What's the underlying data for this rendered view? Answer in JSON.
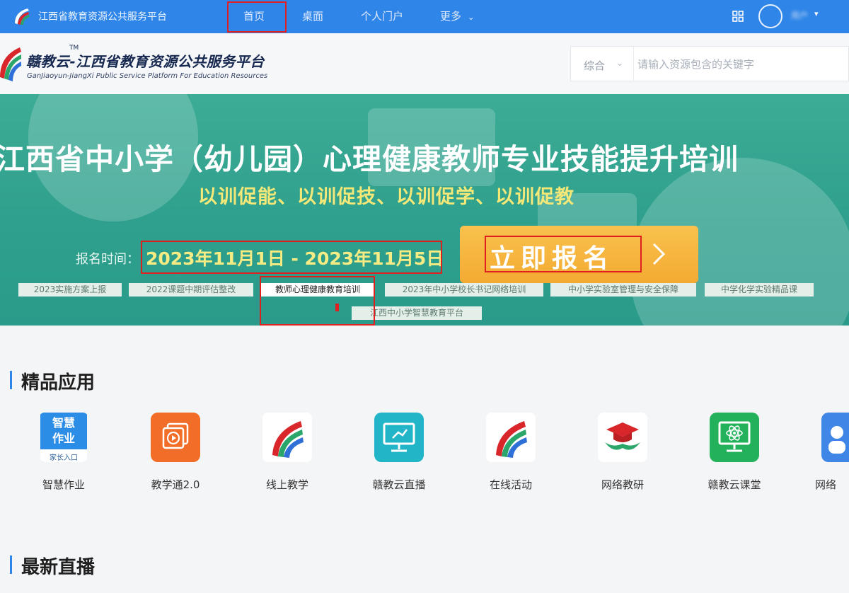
{
  "top_nav": {
    "site_title": "江西省教育资源公共服务平台",
    "items": [
      "首页",
      "桌面",
      "个人门户",
      "更多"
    ],
    "more_caret": "⌄",
    "user_caret": "▾",
    "user_name": "用户",
    "accent_color": "#2f86e8"
  },
  "header": {
    "brand_title": "赣教云-江西省教育资源公共服务平台",
    "brand_tm": "TM",
    "brand_subtitle": "GanJiaoyun-JiangXi Public Service Platform For Education Resources"
  },
  "search": {
    "category": "综合",
    "category_caret": "⌄",
    "placeholder": "请输入资源包含的关键字"
  },
  "banner": {
    "title": "江西省中小学（幼儿园）心理健康教师专业技能提升培训",
    "slogan": "以训促能、以训促技、以训促学、以训促教",
    "reg_label": "报名时间：",
    "reg_dates": "2023年11月1日 - 2023年11月5日",
    "signup_label": "立即报名",
    "quick_links": [
      "2023实施方案上报",
      "2022课题中期评估整改",
      "教师心理健康教育培训",
      "2023年中小学校长书记网络培训",
      "中小学实验室管理与安全保障",
      "中学化学实验精品课",
      "江西中小学智慧教育平台"
    ]
  },
  "apps_section": {
    "title": "精品应用",
    "apps": [
      {
        "name": "智慧作业",
        "icon": "smart-homework-icon",
        "icon_text": [
          "智慧",
          "作业",
          "家长入口"
        ]
      },
      {
        "name": "教学通2.0",
        "icon": "video-play-icon"
      },
      {
        "name": "线上教学",
        "icon": "ganjiaoyun-logo-icon"
      },
      {
        "name": "赣教云直播",
        "icon": "live-screen-icon"
      },
      {
        "name": "在线活动",
        "icon": "ganjiaoyun-logo-icon"
      },
      {
        "name": "网络教研",
        "icon": "graduation-cap-icon"
      },
      {
        "name": "赣教云课堂",
        "icon": "atom-screen-icon"
      },
      {
        "name": "网络",
        "icon": "partial-app-icon"
      }
    ]
  },
  "live_section": {
    "title": "最新直播"
  },
  "colors": {
    "banner_green": "#2fa08d",
    "slogan_yellow": "#f3e878",
    "signup_orange": "#f3aa32",
    "highlight_red": "#e02020"
  }
}
